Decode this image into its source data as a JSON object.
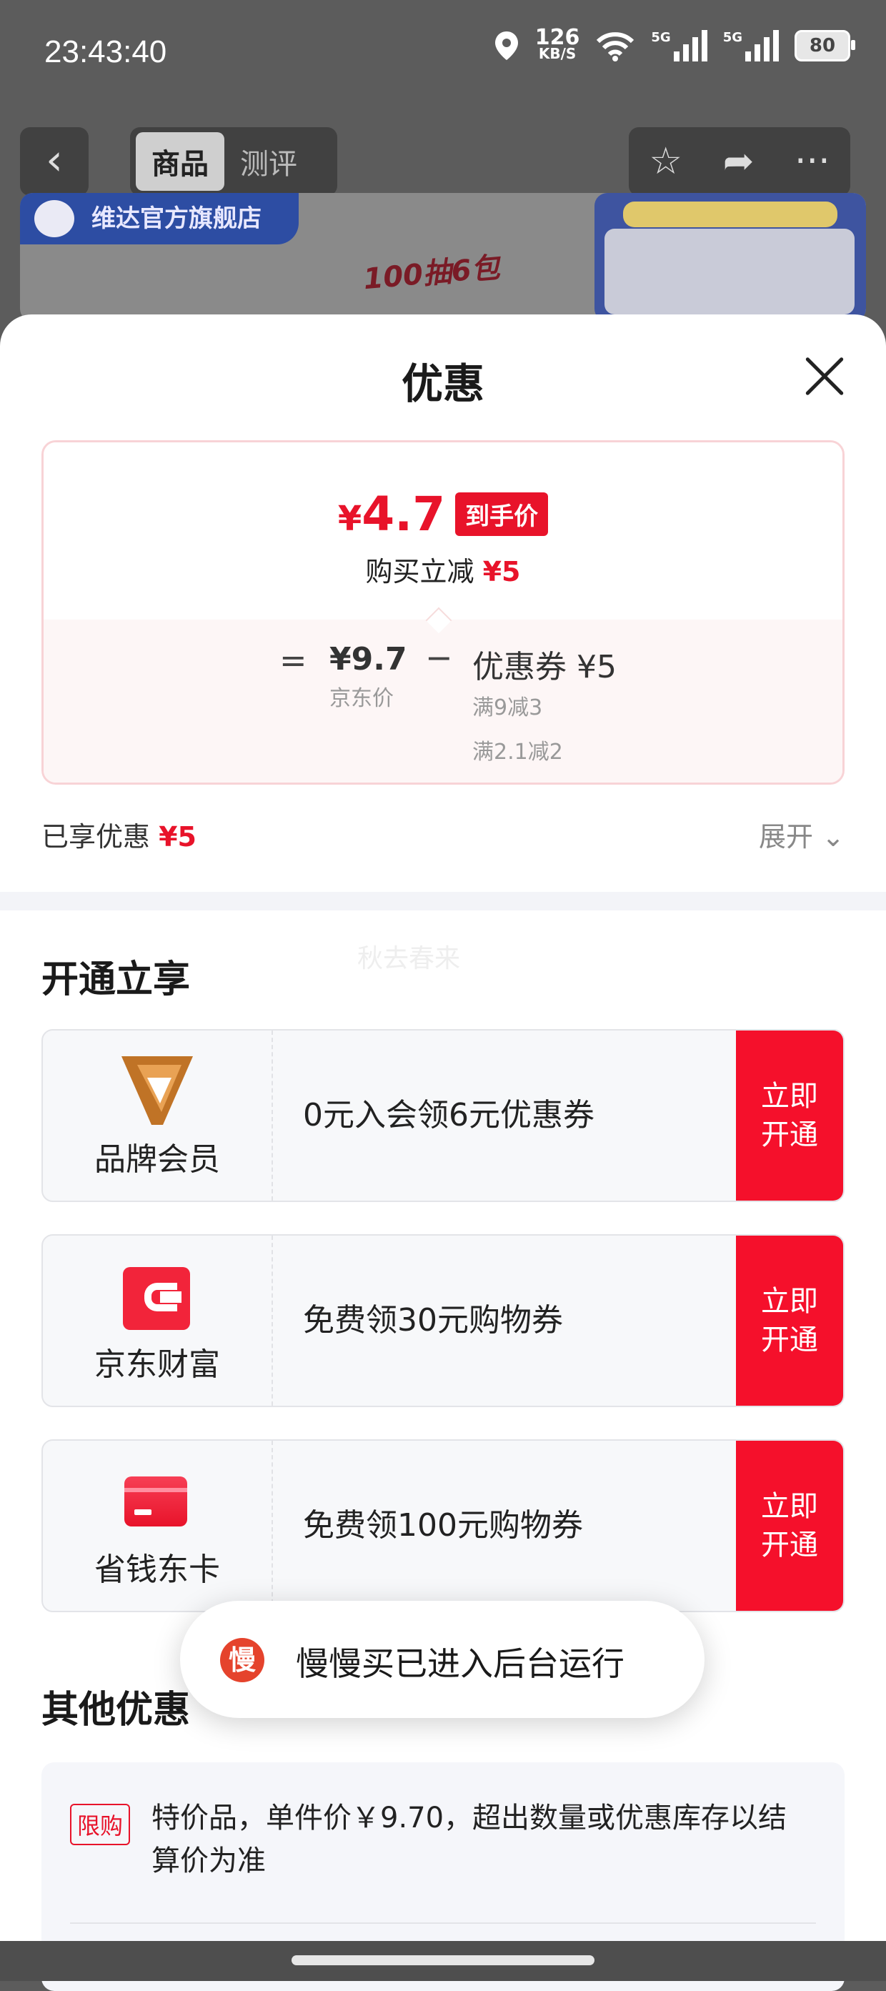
{
  "status_bar": {
    "time": "23:43:40",
    "net_speed": "126",
    "net_unit": "KB/S",
    "sim1": "5G",
    "sim2": "5G",
    "battery": "80"
  },
  "nav": {
    "tabs": [
      "商品",
      "测评"
    ],
    "active_tab": "商品"
  },
  "banner": {
    "store_name": "维达官方旗舰店",
    "promo_text": "100抽6包"
  },
  "sheet": {
    "title": "优惠",
    "final_price": "4.7",
    "currency": "¥",
    "final_price_tag": "到手价",
    "buy_discount_label": "购买立减",
    "buy_discount_value": "¥5",
    "calc": {
      "equals": "=",
      "minus": "−",
      "jd_price": "¥9.7",
      "jd_price_label": "京东价",
      "coupon": "优惠券 ¥5",
      "coupon_rule_1": "满9减3",
      "coupon_rule_2": "满2.1减2"
    },
    "enjoyed_label": "已享优惠",
    "enjoyed_value": "¥5",
    "expand_label": "展开"
  },
  "watermark": "秋去春来",
  "open_section": {
    "title": "开通立享",
    "items": [
      {
        "name": "品牌会员",
        "desc": "0元入会领6元优惠券",
        "button": "立即开通"
      },
      {
        "name": "京东财富",
        "desc": "免费领30元购物券",
        "button": "立即开通"
      },
      {
        "name": "省钱东卡",
        "desc": "免费领100元购物券",
        "button": "立即开通"
      }
    ]
  },
  "other_section": {
    "title": "其他优惠",
    "limit_tag": "限购",
    "limit_text": "特价品，单件价￥9.70，超出数量或优惠库存以结算价为准"
  },
  "toast": {
    "icon_char": "慢",
    "text": "慢慢买已进入后台运行"
  },
  "colors": {
    "accent_red": "#e8132a",
    "button_red": "#f5102b"
  }
}
